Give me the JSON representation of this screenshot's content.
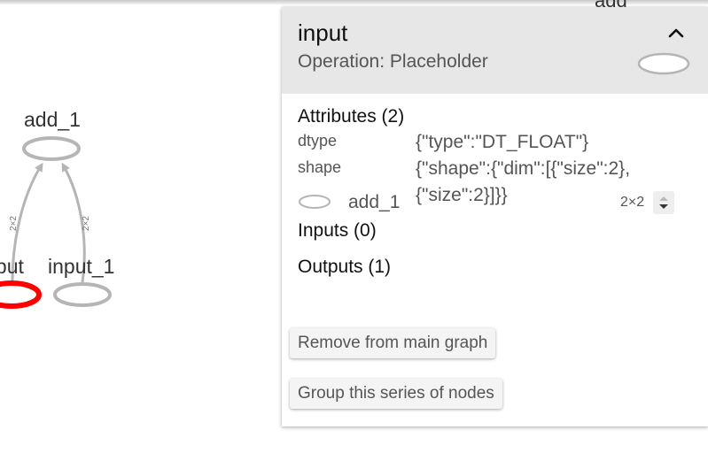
{
  "graph": {
    "nodes": {
      "add_1": "add_1",
      "input": "input",
      "input_1": "input_1",
      "partial_top": "add"
    },
    "edges": {
      "left_shape": "2×2",
      "right_shape": "2×2"
    },
    "selected_color": "#ff0000",
    "node_color": "#b5b5b5"
  },
  "info_card": {
    "title": "input",
    "subtitle": "Operation: Placeholder",
    "collapse_icon": "chevron-up-icon",
    "attributes": {
      "heading": "Attributes (2)",
      "items": [
        {
          "key": "dtype",
          "value_lines": [
            "{\"type\":\"DT_FLOAT\"}"
          ]
        },
        {
          "key": "shape",
          "value_lines": [
            "{\"shape\":{\"dim\":[{\"size\":2},",
            "{\"size\":2}]}}"
          ]
        }
      ]
    },
    "inputs": {
      "heading": "Inputs (0)"
    },
    "outputs": {
      "heading": "Outputs (1)",
      "items": [
        {
          "name": "add_1",
          "shape": "2×2"
        }
      ]
    },
    "buttons": {
      "remove": "Remove from main graph",
      "group": "Group this series of nodes"
    },
    "header_bg": "#e7e7e7"
  }
}
